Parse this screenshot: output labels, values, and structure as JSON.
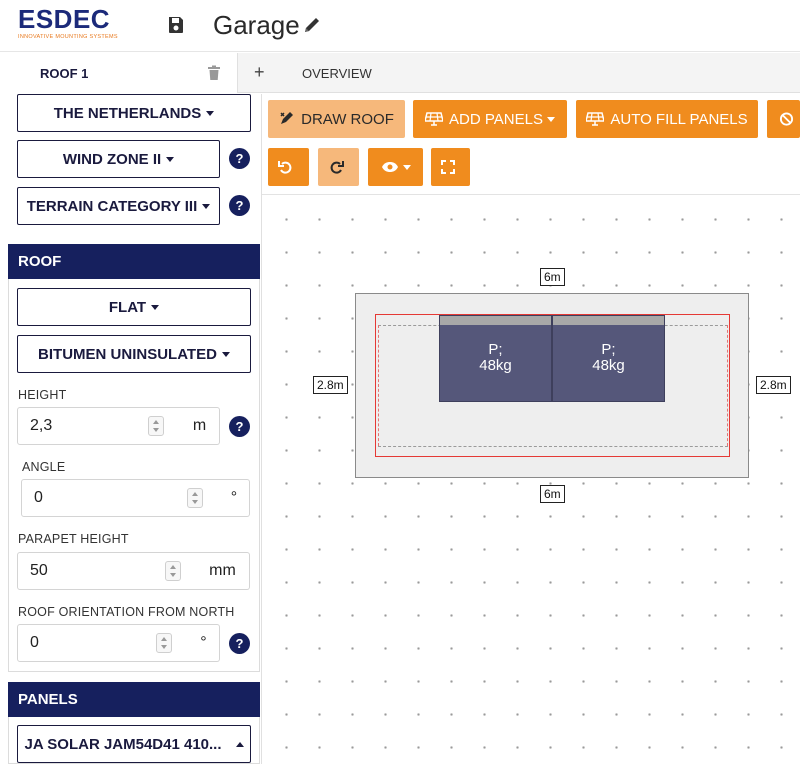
{
  "header": {
    "logo_text": "ESDEC",
    "logo_tagline": "INNOVATIVE MOUNTING SYSTEMS",
    "title": "Garage",
    "icons": [
      "save-icon",
      "pencil-icon"
    ]
  },
  "tabs": {
    "active_label": "ROOF 1",
    "add_label": "+",
    "overview_label": "OVERVIEW"
  },
  "location": {
    "country": "THE NETHERLANDS",
    "wind_zone": "WIND ZONE II",
    "terrain_category": "TERRAIN CATEGORY III",
    "help_glyph": "?"
  },
  "roof": {
    "section_title": "ROOF",
    "type": "FLAT",
    "covering": "BITUMEN UNINSULATED",
    "height_label": "HEIGHT",
    "height_value": "2,3",
    "height_unit": "m",
    "angle_label": "ANGLE",
    "angle_value": "0",
    "angle_unit": "°",
    "parapet_label": "PARAPET HEIGHT",
    "parapet_value": "50",
    "parapet_unit": "mm",
    "orientation_label": "ROOF ORIENTATION FROM NORTH",
    "orientation_value": "0",
    "orientation_unit": "°"
  },
  "panels": {
    "section_title": "PANELS",
    "selected_panel": "JA SOLAR JAM54D41 410..."
  },
  "toolbar": {
    "draw_roof": "DRAW ROOF",
    "add_panels": "ADD PANELS",
    "auto_fill": "AUTO FILL PANELS",
    "icons": [
      "undo-icon",
      "redo-icon",
      "eye-icon",
      "fullscreen-icon"
    ]
  },
  "canvas": {
    "dim_top": "6m",
    "dim_bottom": "6m",
    "dim_left": "2.8m",
    "dim_right": "2.8m",
    "panel_1_label": "P;\n48kg",
    "panel_2_label": "P;\n48kg"
  },
  "colors": {
    "brand_navy": "#16205e",
    "accent_orange": "#f08c1e",
    "panel_fill": "#55577a",
    "setback_red": "#e53935"
  }
}
